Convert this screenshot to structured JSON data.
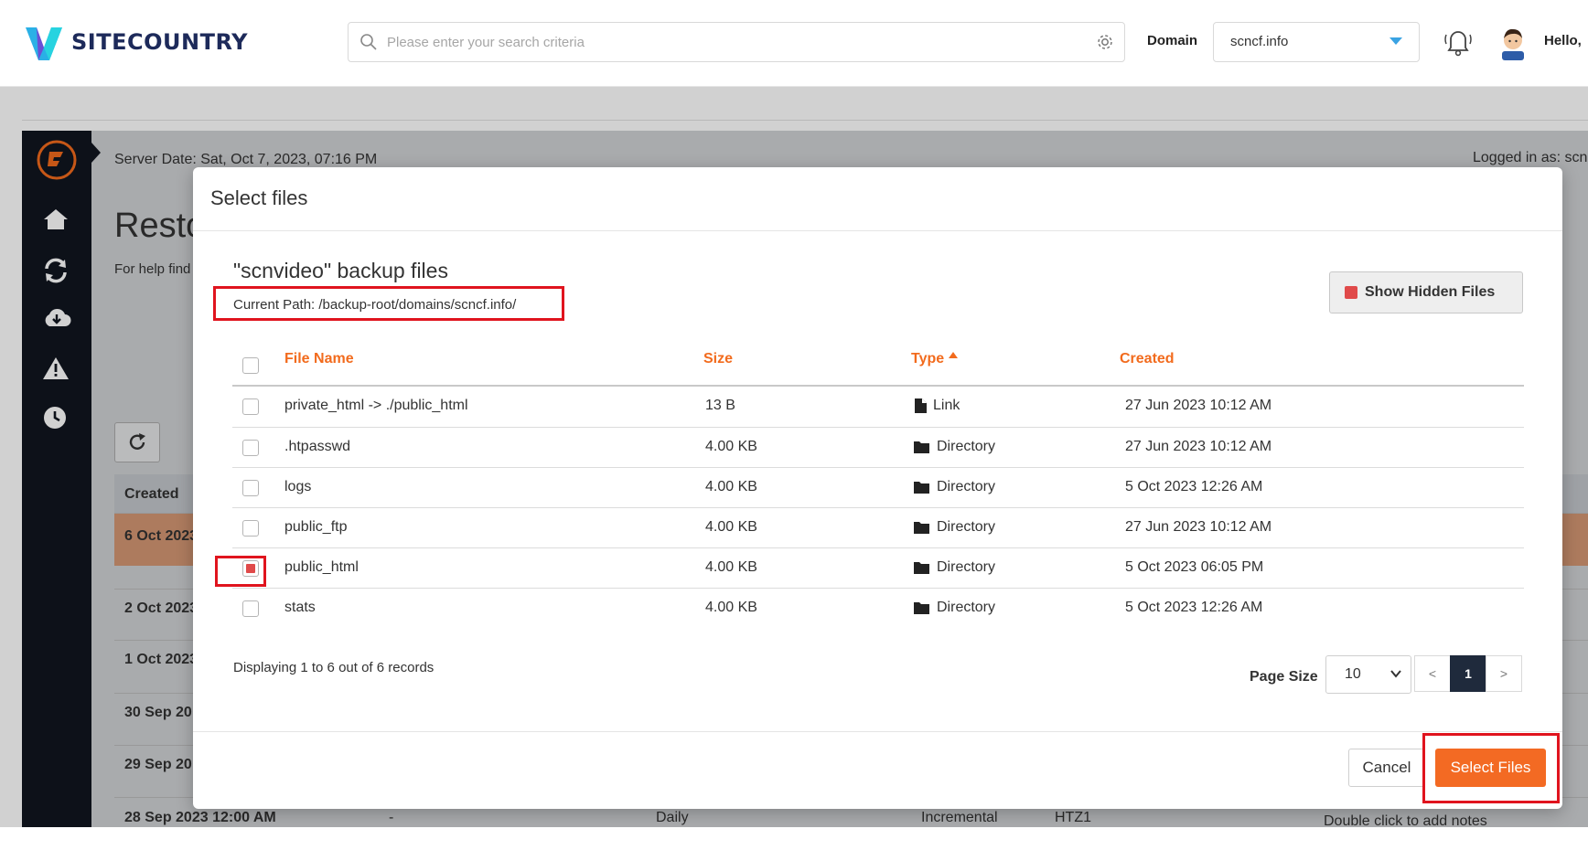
{
  "header": {
    "brand": "SITECOUNTRY",
    "search_placeholder": "Please enter your search criteria",
    "domain_label": "Domain",
    "domain_value": "scncf.info",
    "greeting": "Hello,"
  },
  "background": {
    "server_date": "Server Date: Sat, Oct 7, 2023, 07:16 PM",
    "logged_in": "Logged in as: scn",
    "page_title": "Resto",
    "help_text": "For help find",
    "col_created": "Created",
    "rows": [
      "6 Oct 2023",
      "2 Oct 2023",
      "1 Oct 2023",
      "30 Sep 20",
      "29 Sep 20",
      "28 Sep 2023 12:00 AM"
    ],
    "last_row": {
      "dash": "-",
      "freq": "Daily",
      "kind": "Incremental",
      "loc": "HTZ1",
      "notes": "Double click to add notes"
    }
  },
  "modal": {
    "title": "Select files",
    "backup_title": "\"scnvideo\" backup files",
    "current_path": "Current Path: /backup-root/domains/scncf.info/",
    "show_hidden_label": "Show Hidden Files",
    "columns": {
      "name": "File Name",
      "size": "Size",
      "type": "Type",
      "created": "Created"
    },
    "files": [
      {
        "name": "private_html -> ./public_html",
        "size": "13 B",
        "type": "Link",
        "icon": "file-icon",
        "created": "27 Jun 2023 10:12 AM",
        "checked": false
      },
      {
        "name": ".htpasswd",
        "size": "4.00 KB",
        "type": "Directory",
        "icon": "folder-icon",
        "created": "27 Jun 2023 10:12 AM",
        "checked": false
      },
      {
        "name": "logs",
        "size": "4.00 KB",
        "type": "Directory",
        "icon": "folder-icon",
        "created": "5 Oct 2023 12:26 AM",
        "checked": false
      },
      {
        "name": "public_ftp",
        "size": "4.00 KB",
        "type": "Directory",
        "icon": "folder-icon",
        "created": "27 Jun 2023 10:12 AM",
        "checked": false
      },
      {
        "name": "public_html",
        "size": "4.00 KB",
        "type": "Directory",
        "icon": "folder-icon",
        "created": "5 Oct 2023 06:05 PM",
        "checked": true
      },
      {
        "name": "stats",
        "size": "4.00 KB",
        "type": "Directory",
        "icon": "folder-icon",
        "created": "5 Oct 2023 12:26 AM",
        "checked": false
      }
    ],
    "displaying": "Displaying 1 to 6 out of 6 records",
    "page_size_label": "Page Size",
    "page_size_value": "10",
    "pager": {
      "prev": "<",
      "current": "1",
      "next": ">"
    },
    "cancel_label": "Cancel",
    "select_label": "Select Files"
  },
  "colors": {
    "accent": "#f36a23",
    "highlight": "#e0141e",
    "dark": "#10151f"
  }
}
